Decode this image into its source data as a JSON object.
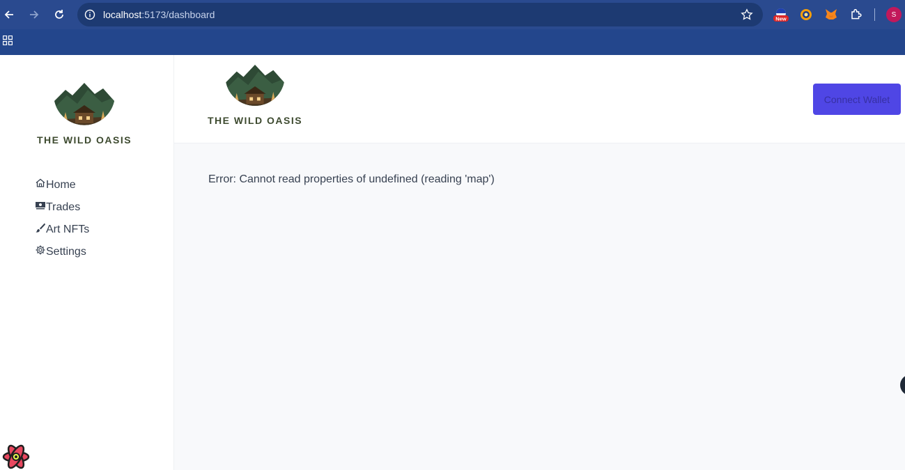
{
  "browser": {
    "url_host": "localhost",
    "url_path": ":5173/dashboard",
    "extension_badge": "New",
    "profile_initial": "S"
  },
  "brand": {
    "name": "THE WILD OASIS"
  },
  "sidebar": {
    "items": [
      {
        "label": "Home",
        "icon": "home-icon"
      },
      {
        "label": "Trades",
        "icon": "money-icon"
      },
      {
        "label": "Art NFTs",
        "icon": "brush-icon"
      },
      {
        "label": "Settings",
        "icon": "gear-icon"
      }
    ]
  },
  "header": {
    "connect_label": "Connect Wallet"
  },
  "main": {
    "error_message": "Error: Cannot read properties of undefined (reading 'map')"
  },
  "colors": {
    "chrome": "#2a4a8f",
    "accent": "#4f46e5",
    "text": "#374151"
  }
}
